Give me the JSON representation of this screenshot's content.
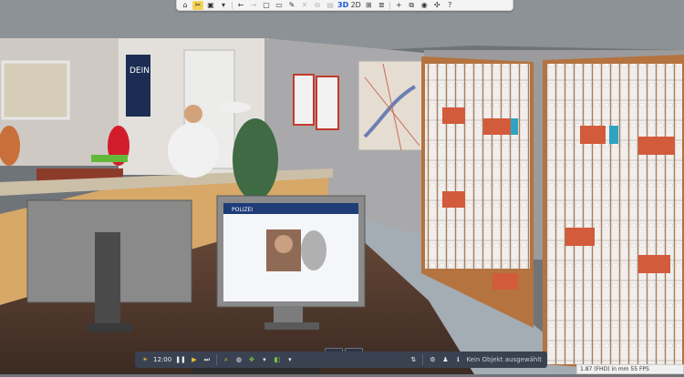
{
  "toolbar": {
    "items": [
      {
        "name": "home-icon",
        "glyph": "⌂"
      },
      {
        "name": "tools-icon",
        "glyph": "✂"
      },
      {
        "name": "save-icon",
        "glyph": "💾"
      },
      {
        "name": "chevron-down-icon",
        "glyph": "▾"
      },
      {
        "name": "undo-icon",
        "glyph": "←"
      },
      {
        "name": "redo-icon",
        "glyph": "→"
      },
      {
        "name": "new-file-icon",
        "glyph": "▢"
      },
      {
        "name": "folder-icon",
        "glyph": "▭"
      },
      {
        "name": "pen-icon",
        "glyph": "✎"
      },
      {
        "name": "delete-icon",
        "glyph": "🗑"
      },
      {
        "name": "copy-icon",
        "glyph": "⧉"
      },
      {
        "name": "paste-icon",
        "glyph": "▤"
      },
      {
        "name": "view-3d",
        "label": "3D"
      },
      {
        "name": "view-2d",
        "label": "2D"
      },
      {
        "name": "grid-icon",
        "glyph": "⊞"
      },
      {
        "name": "layers-icon",
        "glyph": "≣"
      },
      {
        "name": "add-icon",
        "glyph": "+"
      },
      {
        "name": "duplicate-icon",
        "glyph": "⧉"
      },
      {
        "name": "camera-icon",
        "glyph": "◉"
      },
      {
        "name": "puzzle-icon",
        "glyph": "✣"
      },
      {
        "name": "help-icon",
        "glyph": "?"
      }
    ]
  },
  "bottombar": {
    "time": "12:00",
    "status_text": "Kein Objekt ausgewählt"
  },
  "statusbar": {
    "text": "1.87 (FHD) in mm    55 FPS"
  },
  "scene": {
    "poster_text": "DEIN",
    "screen_header": "POLIZEI"
  }
}
